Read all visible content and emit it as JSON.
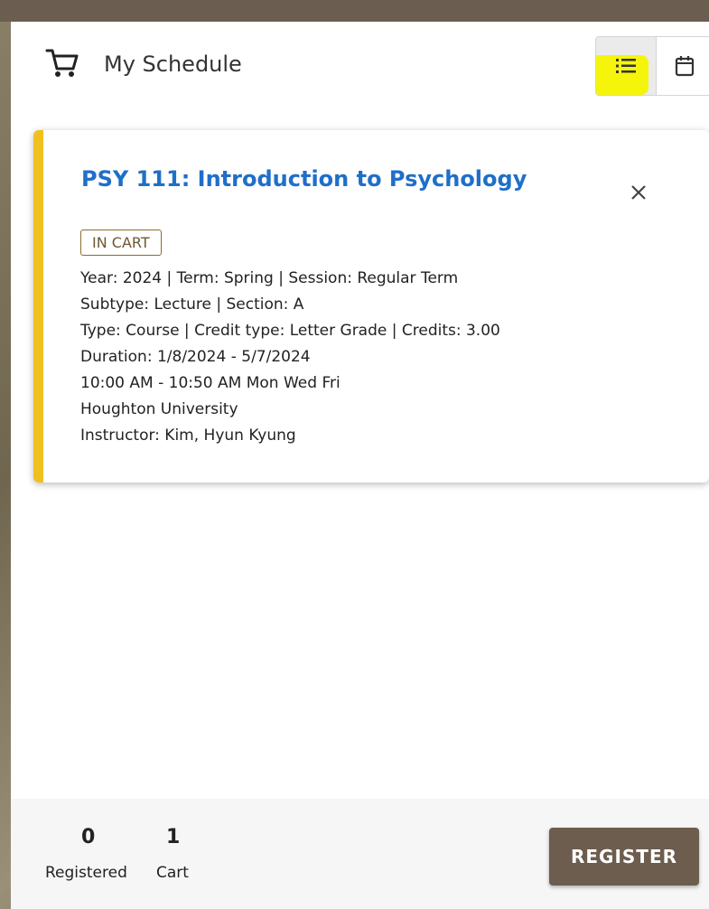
{
  "header": {
    "title": "My Schedule",
    "icon": "shopping-cart-icon"
  },
  "view_toggle": {
    "list_icon": "list-view-icon",
    "calendar_icon": "calendar-icon",
    "active": "list"
  },
  "course_card": {
    "title": "PSY 111: Introduction to Psychology",
    "status_badge": "IN CART",
    "accent_color": "#f0c020",
    "title_color": "#1f6fc9",
    "details": {
      "line1": "Year: 2024 | Term: Spring | Session: Regular Term",
      "line2": "Subtype: Lecture | Section: A",
      "line3": "Type: Course | Credit type: Letter Grade | Credits: 3.00",
      "line4": "Duration: 1/8/2024 - 5/7/2024",
      "line5": "10:00 AM - 10:50 AM Mon Wed Fri",
      "line6": "Houghton University",
      "line7": "Instructor: Kim, Hyun Kyung"
    }
  },
  "footer": {
    "registered_count": "0",
    "registered_label": "Registered",
    "cart_count": "1",
    "cart_label": "Cart",
    "register_button": "REGISTER",
    "register_color": "#6d5d4f"
  }
}
